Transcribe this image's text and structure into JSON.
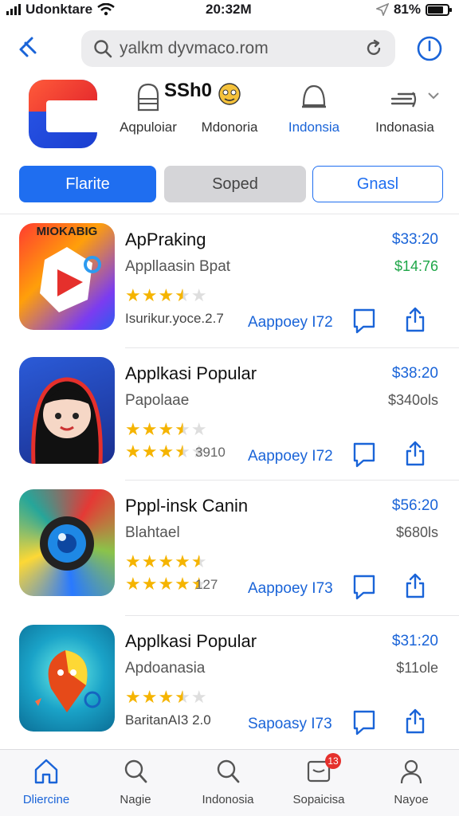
{
  "status_bar": {
    "carrier": "Udonktare",
    "time": "20:32M",
    "battery": "81%"
  },
  "browser": {
    "url": "yalkm dyvmaco.rom"
  },
  "categories": {
    "extra_text": "SSh0",
    "items": [
      {
        "label": "Aqpuloiar"
      },
      {
        "label": "Mdonoria"
      },
      {
        "label": "Indonsia"
      },
      {
        "label": "Indonasia"
      }
    ]
  },
  "segments": [
    "Flarite",
    "Soped",
    "Gnasl"
  ],
  "apps": [
    {
      "name": "ApPraking",
      "subtitle": "Appllaasin Bpat",
      "rating": 3.5,
      "meta": "Isurikur.yoce.2.7",
      "price": "$33:20",
      "price2": "$14:76",
      "price2_color": "#1ea648",
      "get_label": "Aappoey I72",
      "thumb_text": "MIOKABIG"
    },
    {
      "name": "Applkasi Popular",
      "subtitle": "Papolaae",
      "rating": 3.5,
      "meta": "3910",
      "price": "$38:20",
      "price2": "$340ols",
      "price2_color": "#555555",
      "get_label": "Aappoey I72"
    },
    {
      "name": "Pppl-insk Canin",
      "subtitle": "Blahtael",
      "rating": 4.5,
      "meta": "127",
      "price": "$56:20",
      "price2": "$680ls",
      "price2_color": "#555555",
      "get_label": "Aappoey I73"
    },
    {
      "name": "Applkasi Popular",
      "subtitle": "Apdoanasia",
      "rating": 3.5,
      "meta": "BaritanAI3 2.0",
      "price": "$31:20",
      "price2": "$11ole",
      "price2_color": "#555555",
      "get_label": "Sapoasy I73"
    }
  ],
  "tabbar": [
    {
      "label": "Dliercine",
      "icon": "home-icon",
      "active": true
    },
    {
      "label": "Nagie",
      "icon": "search-icon"
    },
    {
      "label": "Indonosia",
      "icon": "search-icon"
    },
    {
      "label": "Sopaicisa",
      "icon": "inbox-icon",
      "badge": "13"
    },
    {
      "label": "Nayoe",
      "icon": "person-icon"
    }
  ],
  "colors": {
    "accent": "#1f6ef0",
    "star": "#f5b400",
    "badge": "#e5302c"
  }
}
